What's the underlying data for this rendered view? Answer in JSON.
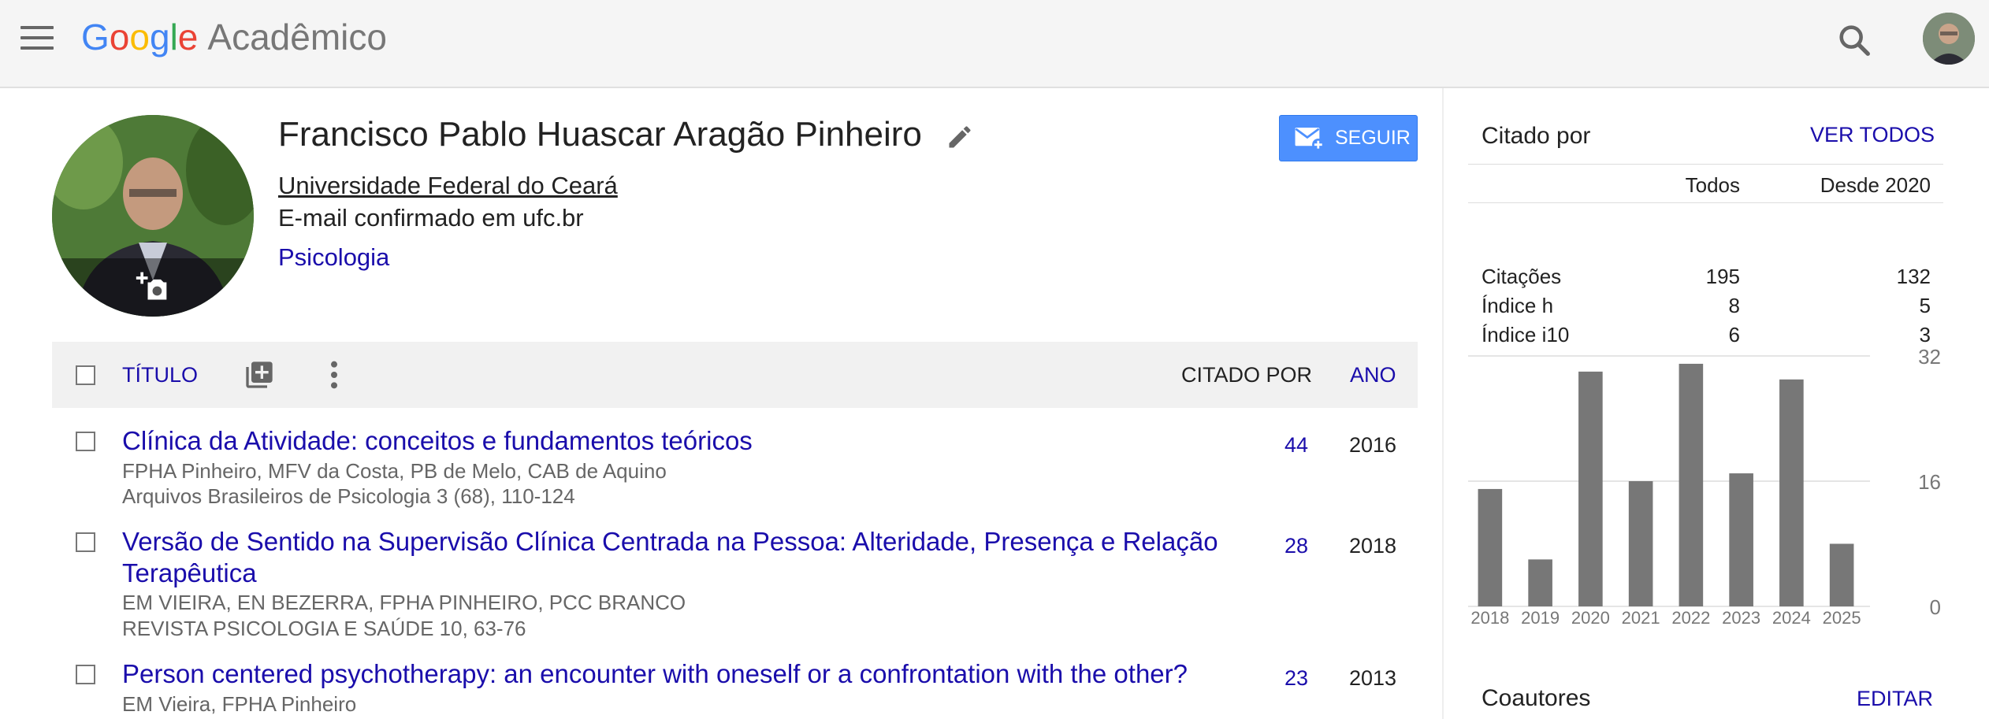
{
  "app": {
    "brand_letters": [
      "G",
      "o",
      "o",
      "g",
      "l",
      "e"
    ],
    "brand_suffix": "Acadêmico"
  },
  "profile": {
    "name": "Francisco Pablo Huascar Aragão Pinheiro",
    "affiliation": "Universidade Federal do Ceará",
    "email_verified": "E-mail confirmado em ufc.br",
    "interest": "Psicologia",
    "follow_label": "SEGUIR"
  },
  "table": {
    "header": {
      "title": "TÍTULO",
      "cited_by": "CITADO POR",
      "year": "ANO"
    },
    "rows": [
      {
        "title": "Clínica da Atividade: conceitos e fundamentos teóricos",
        "authors": "FPHA Pinheiro, MFV da Costa, PB de Melo, CAB de Aquino",
        "venue": "Arquivos Brasileiros de Psicologia 3 (68), 110-124",
        "cites": "44",
        "year": "2016"
      },
      {
        "title": "Versão de Sentido na Supervisão Clínica Centrada na Pessoa: Alteridade, Presença e Relação Terapêutica",
        "authors": "EM VIEIRA, EN BEZERRA, FPHA PINHEIRO, PCC BRANCO",
        "venue": "REVISTA PSICOLOGIA E SAÚDE 10, 63-76",
        "cites": "28",
        "year": "2018"
      },
      {
        "title": "Person centered psychotherapy: an encounter with oneself or a confrontation with the other?",
        "authors": "EM Vieira, FPHA Pinheiro",
        "venue": "",
        "cites": "23",
        "year": "2013"
      }
    ]
  },
  "sidebar": {
    "cited_by_title": "Citado por",
    "view_all": "VER TODOS",
    "stats_header": {
      "all": "Todos",
      "since": "Desde 2020"
    },
    "stats": [
      {
        "label": "Citações",
        "all": "195",
        "since": "132"
      },
      {
        "label": "Índice h",
        "all": "8",
        "since": "5"
      },
      {
        "label": "Índice i10",
        "all": "6",
        "since": "3"
      }
    ],
    "coauthors_title": "Coautores",
    "edit_label": "EDITAR"
  },
  "chart_data": {
    "type": "bar",
    "categories": [
      "2018",
      "2019",
      "2020",
      "2021",
      "2022",
      "2023",
      "2024",
      "2025"
    ],
    "values": [
      15,
      6,
      30,
      16,
      31,
      17,
      29,
      8
    ],
    "ylim": [
      0,
      32
    ],
    "yticks": [
      "0",
      "16",
      "32"
    ],
    "grid": true,
    "bar_color": "#777777"
  }
}
